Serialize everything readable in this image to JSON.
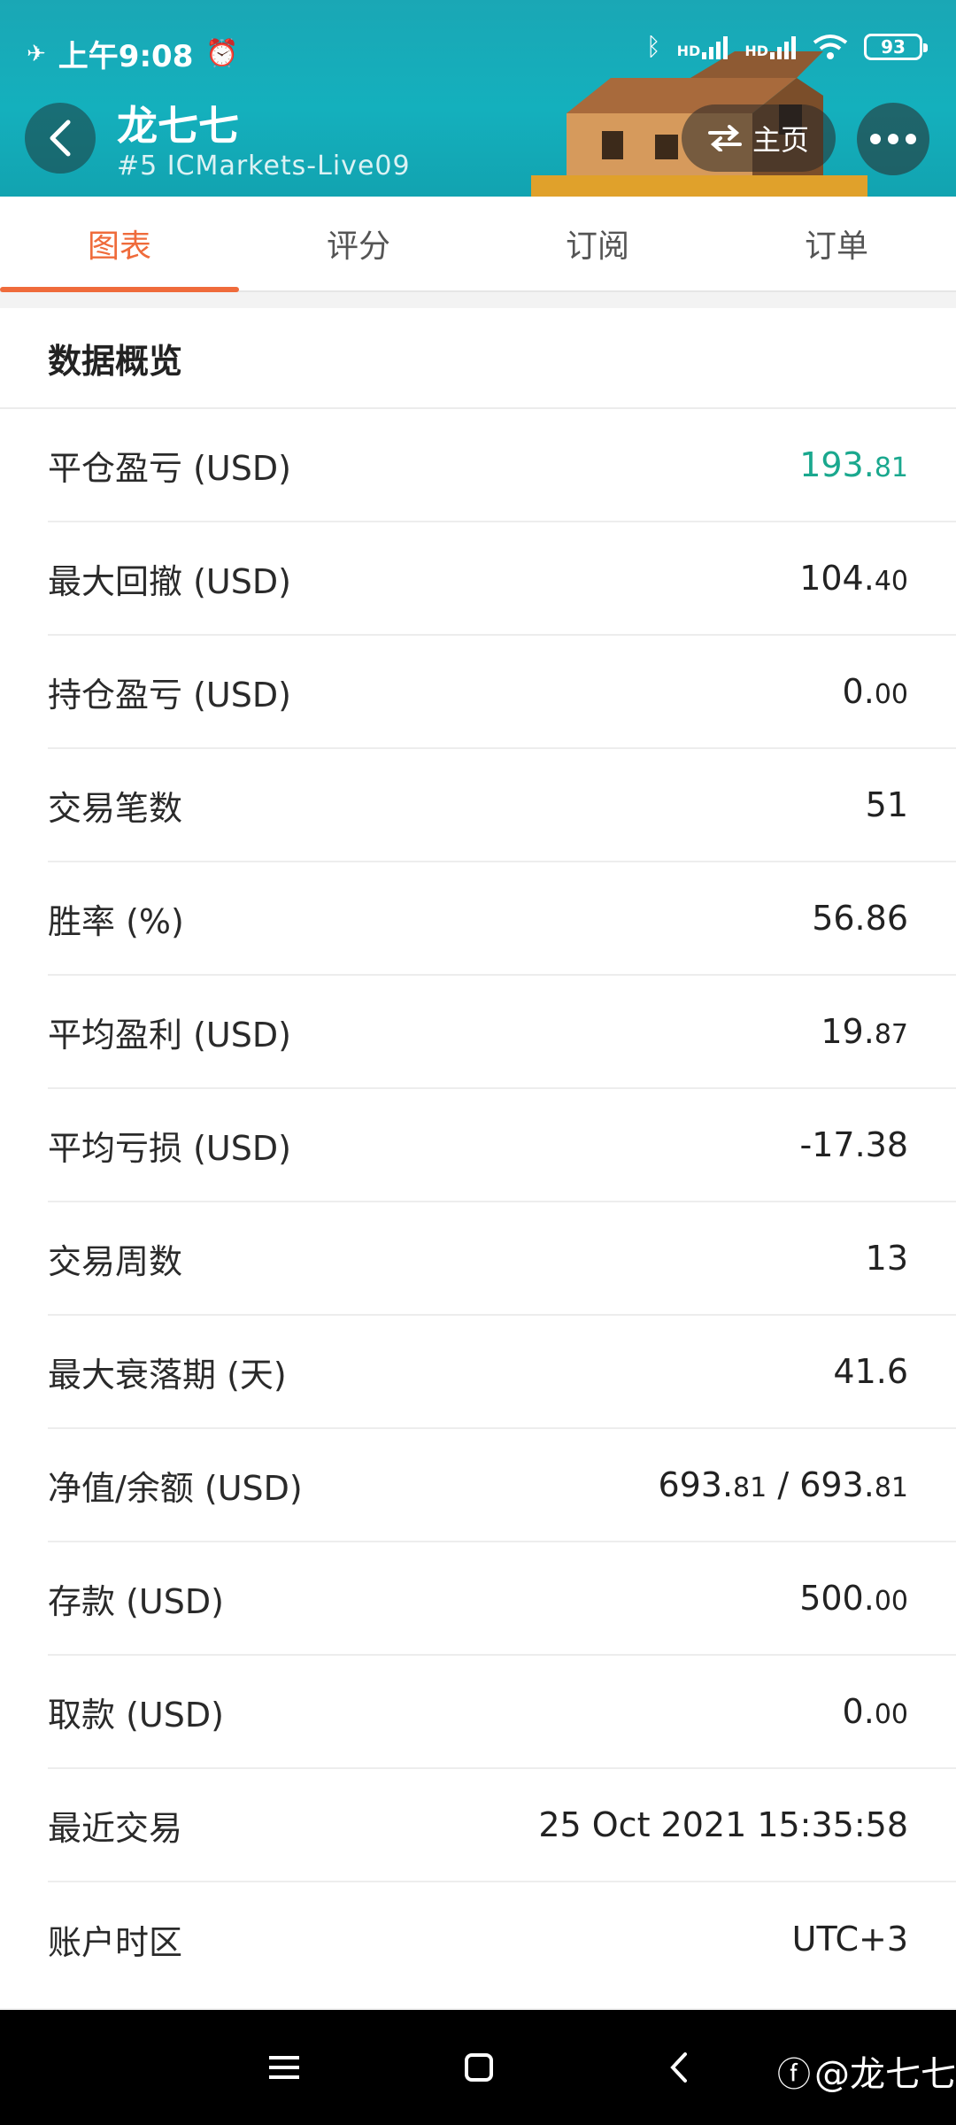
{
  "colors": {
    "accent": "#ef6b3b",
    "positive": "#1aa88e",
    "header_bg": "#14b0bd"
  },
  "status_bar": {
    "time": "上午9:08",
    "network_1": "HD",
    "network_2": "HD",
    "battery": "93"
  },
  "header": {
    "name": "龙七七",
    "subtitle": "#5  ICMarkets-Live09",
    "home_label": "主页",
    "icons": {
      "back": "chevron-left-icon",
      "switch": "swap-arrows-icon",
      "more": "ellipsis-icon"
    }
  },
  "tabs": [
    {
      "label": "图表",
      "active": true
    },
    {
      "label": "评分",
      "active": false
    },
    {
      "label": "订阅",
      "active": false
    },
    {
      "label": "订单",
      "active": false
    }
  ],
  "overview": {
    "title": "数据概览",
    "rows": [
      {
        "label": "平仓盈亏 (USD)",
        "main": "193.",
        "dec": "81"
      },
      {
        "label": "最大回撤 (USD)",
        "main": "104.",
        "dec": "40"
      },
      {
        "label": "持仓盈亏 (USD)",
        "main": "0.",
        "dec": "00"
      },
      {
        "label": "交易笔数",
        "main": "51",
        "dec": ""
      },
      {
        "label": "胜率 (%)",
        "main": "56.86",
        "dec": ""
      },
      {
        "label": "平均盈利 (USD)",
        "main": "19.",
        "dec": "87"
      },
      {
        "label": "平均亏损 (USD)",
        "main": "-17.38",
        "dec": ""
      },
      {
        "label": "交易周数",
        "main": "13",
        "dec": ""
      },
      {
        "label": "最大衰落期 (天)",
        "main": "41.6",
        "dec": ""
      },
      {
        "label": "净值/余额 (USD)",
        "main": "693.",
        "dec": "81",
        "main2": " / 693.",
        "dec2": "81"
      },
      {
        "label": "存款 (USD)",
        "main": "500.",
        "dec": "00"
      },
      {
        "label": "取款 (USD)",
        "main": "0.",
        "dec": "00"
      },
      {
        "label": "最近交易",
        "main": "25 Oct 2021 15:35:58",
        "dec": ""
      },
      {
        "label": "账户时区",
        "main": "UTC+3",
        "dec": ""
      }
    ]
  },
  "navbar": {
    "watermark": "@龙七七"
  }
}
